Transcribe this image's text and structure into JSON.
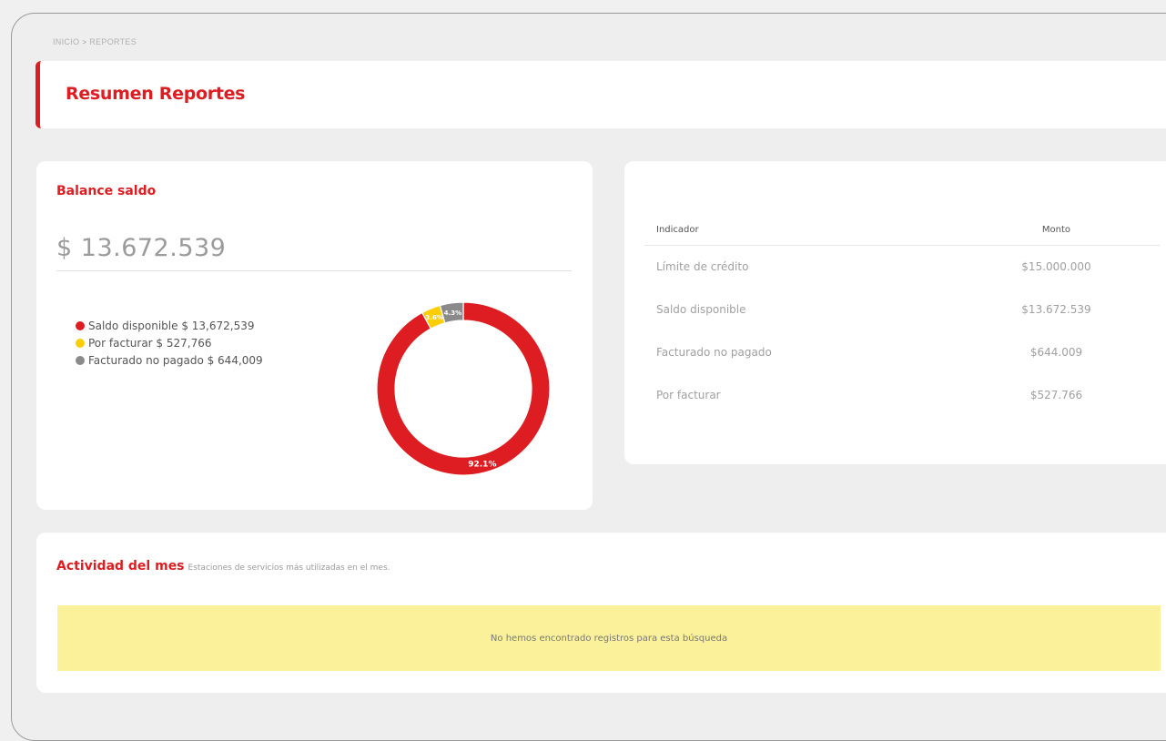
{
  "breadcrumb": {
    "home": "INICIO",
    "separator": ">",
    "current": "REPORTES"
  },
  "page_title": "Resumen Reportes",
  "balance": {
    "title": "Balance saldo",
    "amount": "$ 13.672.539",
    "legend": [
      {
        "label": "Saldo disponible $ 13,672,539",
        "color": "#dd1d21"
      },
      {
        "label": "Por facturar $ 527,766",
        "color": "#fbce07"
      },
      {
        "label": "Facturado no pagado $ 644,009",
        "color": "#8a8a8a"
      }
    ],
    "chart_data": {
      "type": "pie",
      "categories": [
        "Saldo disponible",
        "Por facturar",
        "Facturado no pagado"
      ],
      "values": [
        13672539,
        527766,
        644009
      ],
      "percent_labels": [
        "92.1%",
        "3.6%",
        "4.3%"
      ],
      "colors": [
        "#dd1d21",
        "#fbce07",
        "#8a8a8a"
      ]
    }
  },
  "indicators": {
    "headers": {
      "indicator": "Indicador",
      "amount": "Monto"
    },
    "rows": [
      {
        "indicator": "Límite de crédito",
        "amount": "$15.000.000"
      },
      {
        "indicator": "Saldo disponible",
        "amount": "$13.672.539"
      },
      {
        "indicator": "Facturado no pagado",
        "amount": "$644.009"
      },
      {
        "indicator": "Por facturar",
        "amount": "$527.766"
      }
    ]
  },
  "activity": {
    "title": "Actividad del mes",
    "subtitle": "Estaciones de servicios más utilizadas en el mes.",
    "empty_message": "No hemos encontrado registros para esta búsqueda"
  }
}
